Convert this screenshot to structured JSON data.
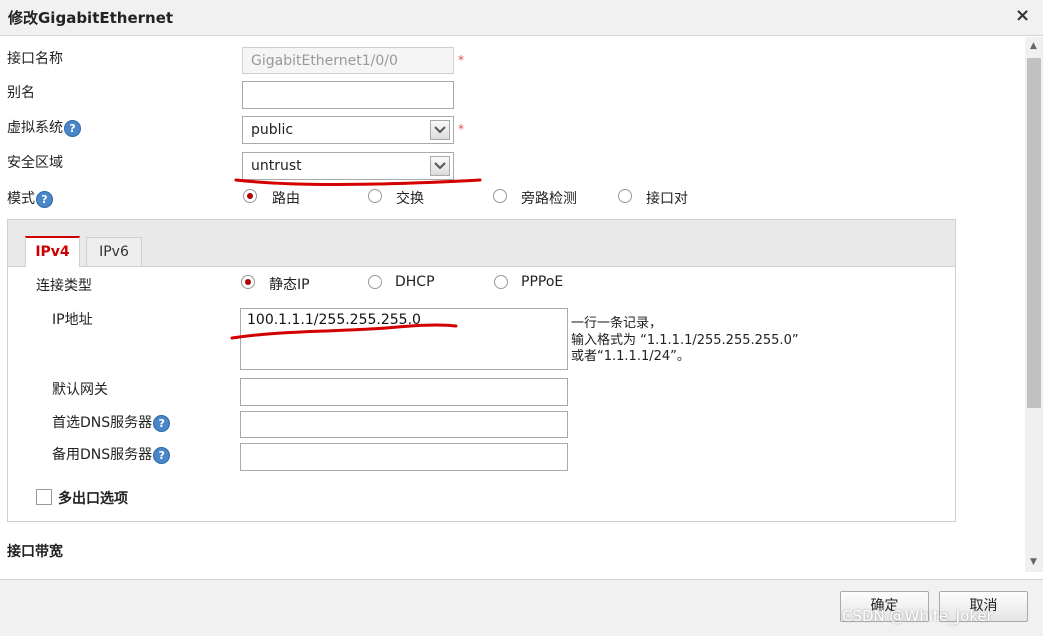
{
  "window": {
    "title": "修改GigabitEthernet",
    "close_icon": "×"
  },
  "form": {
    "interface_name": {
      "label": "接口名称",
      "value": "GigabitEthernet1/0/0",
      "required_mark": "*"
    },
    "alias": {
      "label": "别名",
      "value": ""
    },
    "virtual_system": {
      "label": "虚拟系统",
      "help": "?",
      "value": "public",
      "required_mark": "*"
    },
    "security_zone": {
      "label": "安全区域",
      "value": "untrust"
    },
    "mode": {
      "label": "模式",
      "help": "?",
      "options": [
        "路由",
        "交换",
        "旁路检测",
        "接口对"
      ],
      "selected": "路由"
    }
  },
  "tabs": [
    {
      "label": "IPv4",
      "active": true
    },
    {
      "label": "IPv6",
      "active": false
    }
  ],
  "ipv4": {
    "connection_type": {
      "label": "连接类型",
      "options": [
        "静态IP",
        "DHCP",
        "PPPoE"
      ],
      "selected": "静态IP"
    },
    "ip_address": {
      "label": "IP地址",
      "value": "100.1.1.1/255.255.255.0",
      "hint_lines": [
        "一行一条记录，",
        "输入格式为 “1.1.1.1/255.255.255.0”",
        "或者“1.1.1.1/24”。"
      ]
    },
    "default_gateway": {
      "label": "默认网关",
      "value": ""
    },
    "primary_dns": {
      "label": "首选DNS服务器",
      "help": "?",
      "value": ""
    },
    "secondary_dns": {
      "label": "备用DNS服务器",
      "help": "?",
      "value": ""
    },
    "multi_egress": {
      "label": "多出口选项",
      "checked": false
    }
  },
  "bandwidth_section": {
    "label": "接口带宽"
  },
  "footer": {
    "ok_label": "确定",
    "cancel_label": "取消"
  },
  "watermark": "CSDN @White_Joker",
  "colors": {
    "accent_red": "#c00000",
    "annotation_red": "#d40000",
    "radio_selected": "#b00000"
  }
}
